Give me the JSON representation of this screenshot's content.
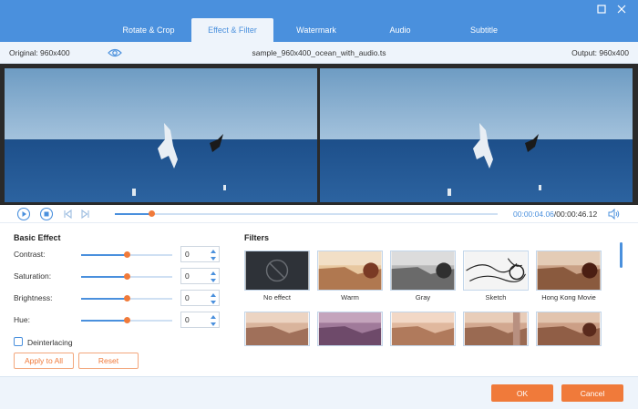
{
  "tabs": [
    {
      "label": "Rotate & Crop"
    },
    {
      "label": "Effect & Filter"
    },
    {
      "label": "Watermark"
    },
    {
      "label": "Audio"
    },
    {
      "label": "Subtitle"
    }
  ],
  "active_tab": "Effect & Filter",
  "info": {
    "original": "Original: 960x400",
    "filename": "sample_960x400_ocean_with_audio.ts",
    "output": "Output: 960x400"
  },
  "playback": {
    "current_time": "00:00:04.06",
    "separator": "/",
    "total_time": "00:00:46.12",
    "progress": 0.095
  },
  "basic_effect": {
    "title": "Basic Effect",
    "rows": [
      {
        "label": "Contrast:",
        "value": "0",
        "level": 0.5
      },
      {
        "label": "Saturation:",
        "value": "0",
        "level": 0.5
      },
      {
        "label": "Brightness:",
        "value": "0",
        "level": 0.5
      },
      {
        "label": "Hue:",
        "value": "0",
        "level": 0.5
      }
    ],
    "deinterlacing_label": "Deinterlacing",
    "apply_all_label": "Apply to All",
    "reset_label": "Reset"
  },
  "filters": {
    "title": "Filters",
    "items": [
      {
        "label": "No effect"
      },
      {
        "label": "Warm"
      },
      {
        "label": "Gray"
      },
      {
        "label": "Sketch"
      },
      {
        "label": "Hong Kong Movie"
      }
    ]
  },
  "footer": {
    "ok_label": "OK",
    "cancel_label": "Cancel"
  },
  "colors": {
    "accent": "#4a90dd",
    "orange": "#f07a3a",
    "panel": "#eef4fb"
  }
}
